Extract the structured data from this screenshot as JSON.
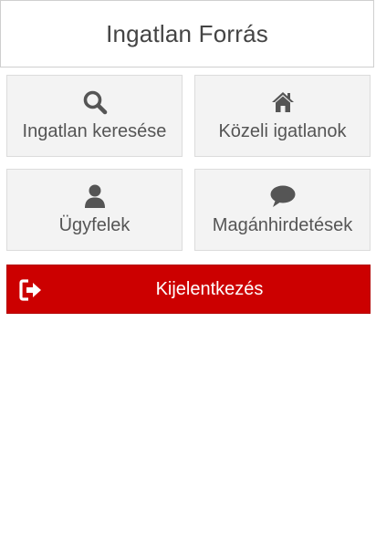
{
  "header": {
    "title": "Ingatlan Forrás"
  },
  "tiles": [
    {
      "label": "Ingatlan keresése",
      "icon": "search-icon"
    },
    {
      "label": "Közeli igatlanok",
      "icon": "home-icon"
    },
    {
      "label": "Ügyfelek",
      "icon": "user-icon"
    },
    {
      "label": "Magánhirdetések",
      "icon": "comment-icon"
    }
  ],
  "logout": {
    "label": "Kijelentkezés",
    "icon": "sign-out-icon"
  },
  "colors": {
    "accent": "#cc0000",
    "tile_bg": "#f3f3f3",
    "icon": "#555555",
    "text": "#555555"
  }
}
